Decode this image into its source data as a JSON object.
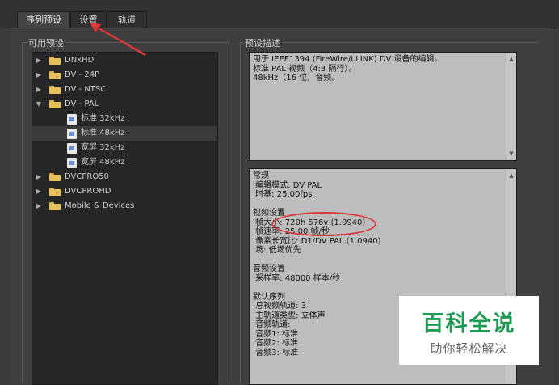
{
  "tabs": [
    {
      "label": "序列预设"
    },
    {
      "label": "设置"
    },
    {
      "label": "轨道"
    }
  ],
  "left_panel": {
    "title": "可用预设",
    "items": [
      {
        "label": "DNxHD",
        "expanded": false
      },
      {
        "label": "DV - 24P",
        "expanded": false
      },
      {
        "label": "DV - NTSC",
        "expanded": false
      },
      {
        "label": "DV - PAL",
        "expanded": true
      },
      {
        "label": "标准 32kHz"
      },
      {
        "label": "标准 48kHz"
      },
      {
        "label": "宽屏 32kHz"
      },
      {
        "label": "宽屏 48kHz"
      },
      {
        "label": "DVCPRO50",
        "expanded": false
      },
      {
        "label": "DVCPROHD",
        "expanded": false
      },
      {
        "label": "Mobile & Devices",
        "expanded": false
      }
    ]
  },
  "right_panel": {
    "title": "预设描述",
    "description": "用于 IEEE1394 (FireWire/i.LINK) DV 设备的编辑。\n标准 PAL 视频（4:3 隔行）。\n48kHz（16 位）音频。",
    "details": "常规\n 编辑模式: DV PAL\n 时基: 25.00fps\n\n视频设置\n 帧大小: 720h 576v (1.0940)\n 帧速率: 25.00 帧/秒\n 像素长宽比: D1/DV PAL (1.0940)\n 场: 低场优先\n\n音频设置\n 采样率: 48000 样本/秒\n\n默认序列\n 总视频轨道: 3\n 主轨道类型: 立体声\n 音频轨道:\n 音频1: 标准\n 音频2: 标准\n 音频3: 标准"
  },
  "watermark": {
    "title": "百科全说",
    "subtitle": "助你轻松解决"
  },
  "colors": {
    "annotation": "#d63a3a",
    "watermark_green": "#1f9a52",
    "folder": "#e6c05b"
  }
}
